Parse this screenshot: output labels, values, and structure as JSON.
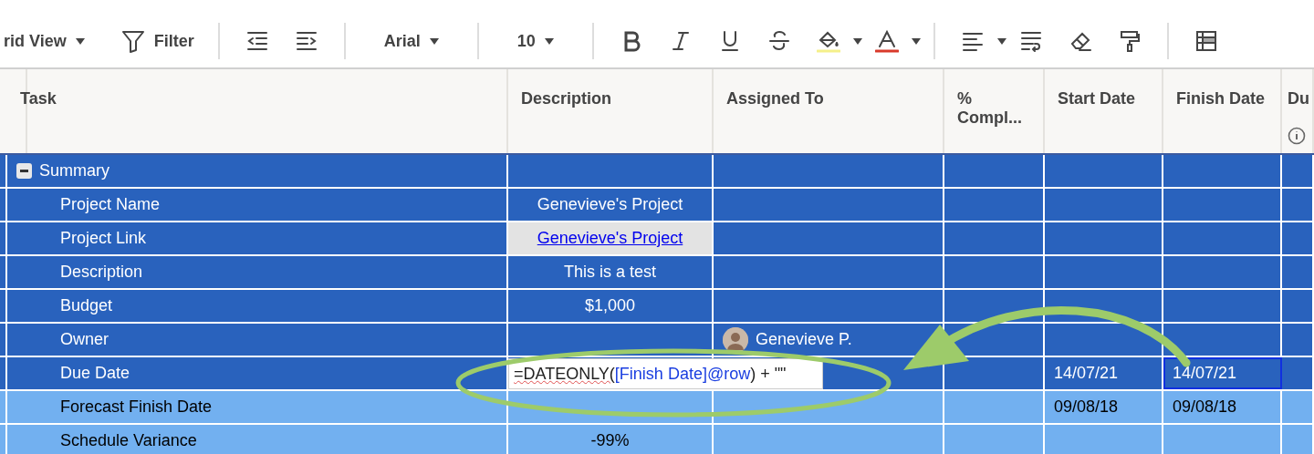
{
  "toolbar": {
    "view": "rid View",
    "filter": "Filter",
    "font": "Arial",
    "font_size": "10"
  },
  "columns": [
    {
      "label": "Task"
    },
    {
      "label": "Description"
    },
    {
      "label": "Assigned To"
    },
    {
      "label": "% Compl..."
    },
    {
      "label": "Start Date"
    },
    {
      "label": "Finish Date"
    },
    {
      "label": "Du",
      "info": true
    }
  ],
  "rows": [
    {
      "task": "Summary",
      "expanded": true,
      "selected": true,
      "children": [
        {
          "task": "Project Name",
          "description": "Genevieve's Project",
          "link": false,
          "selected": true,
          "finish_focused": false
        },
        {
          "task": "Project Link",
          "description": "Genevieve's Project",
          "link": true,
          "selected": true,
          "finish_focused": false
        },
        {
          "task": "Description",
          "description": "This is a test",
          "link": false,
          "selected": true,
          "finish_focused": false
        },
        {
          "task": "Budget",
          "description": "$1,000",
          "link": false,
          "selected": true,
          "finish_focused": false
        },
        {
          "task": "Owner",
          "assigned_to": "Genevieve P.",
          "link": false,
          "selected": true,
          "finish_focused": false
        },
        {
          "task": "Due Date",
          "formula": {
            "function": "=DATEONLY(",
            "reference": "[Finish Date]@row",
            "rest": ") + \"\""
          },
          "start_date": "14/07/21",
          "finish_date": "14/07/21",
          "link": false,
          "selected": true,
          "finish_focused": true
        },
        {
          "task": "Forecast Finish Date",
          "start_date": "09/08/18",
          "finish_date": "09/08/18",
          "link": false,
          "selected": false,
          "finish_focused": false
        },
        {
          "task": "Schedule Variance",
          "description": "-99%",
          "link": false,
          "selected": false,
          "finish_focused": false
        }
      ]
    }
  ]
}
